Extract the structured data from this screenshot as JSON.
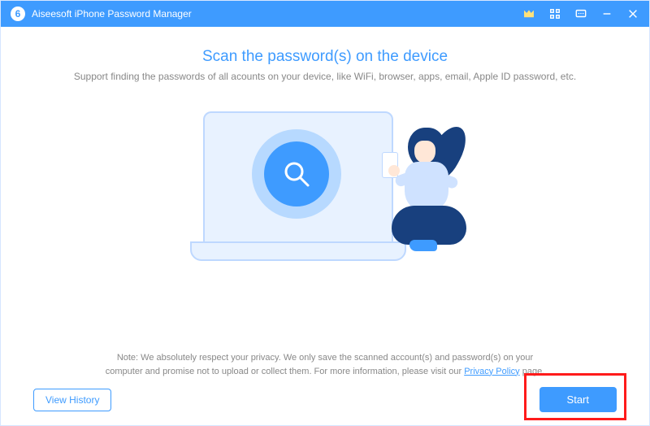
{
  "titlebar": {
    "app_name": "Aiseesoft iPhone Password Manager"
  },
  "main": {
    "heading": "Scan the password(s) on the device",
    "subheading": "Support finding the passwords of all acounts on your device, like  WiFi, browser, apps, email, Apple ID password, etc."
  },
  "note": {
    "line1": "Note: We absolutely respect your privacy. We only save the scanned account(s) and password(s) on your",
    "line2_prefix": "computer and promise not to upload or collect them. For more information, please visit our ",
    "privacy_link_text": "Privacy Policy",
    "line2_suffix": " page."
  },
  "buttons": {
    "view_history": "View History",
    "start": "Start"
  }
}
